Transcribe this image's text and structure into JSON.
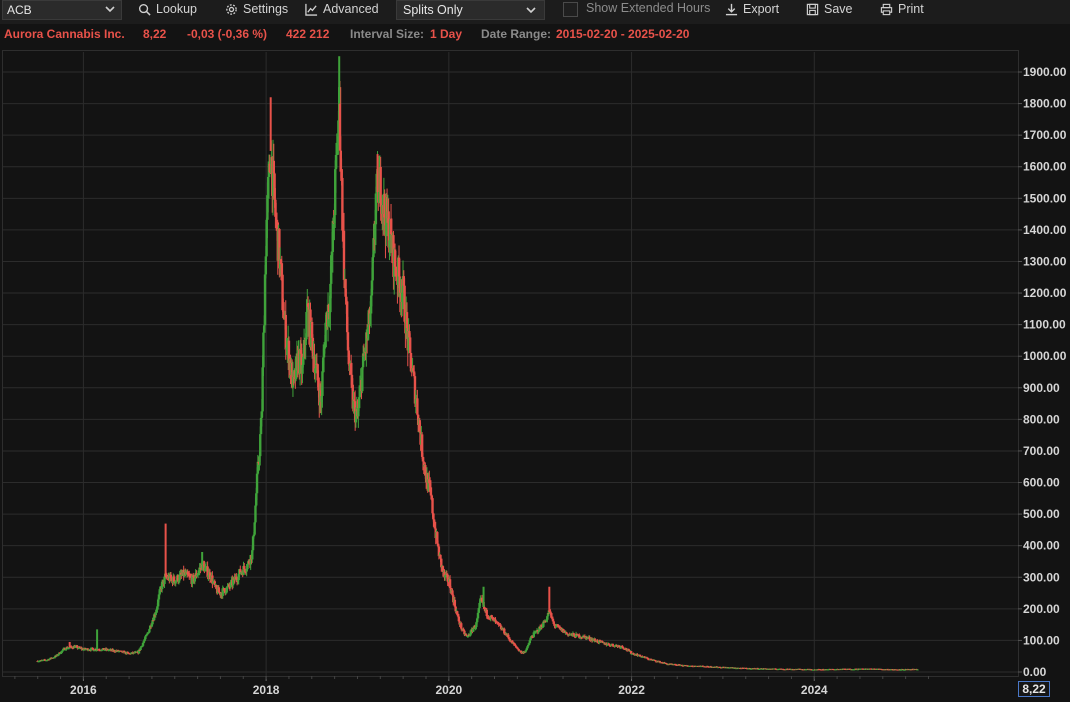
{
  "toolbar": {
    "symbol": "ACB",
    "lookup": "Lookup",
    "settings": "Settings",
    "advanced": "Advanced",
    "splits_select": "Splits Only",
    "extended_hours": "Show Extended Hours",
    "export": "Export",
    "save": "Save",
    "print": "Print"
  },
  "info": {
    "company": "Aurora Cannabis Inc.",
    "last": "8,22",
    "change": "-0,03 (-0,36 %)",
    "volume": "422 212",
    "interval_label": "Interval Size:",
    "interval_value": "1 Day",
    "range_label": "Date Range:",
    "range_value": "2015-02-20 - 2025-02-20"
  },
  "colors": {
    "up": "#3fa33a",
    "down": "#e8524a",
    "grid": "#2c2c2c",
    "accent": "#e8524a"
  },
  "chart_data": {
    "type": "candlestick",
    "ylim": [
      0,
      1900
    ],
    "yticks": [
      "1900.00",
      "1800.00",
      "1700.00",
      "1600.00",
      "1500.00",
      "1400.00",
      "1300.00",
      "1200.00",
      "1100.00",
      "1000.00",
      "900.00",
      "800.00",
      "700.00",
      "600.00",
      "500.00",
      "400.00",
      "300.00",
      "200.00",
      "100.00",
      "0.00"
    ],
    "xticks": [
      {
        "label": "2016",
        "x": 2016.0
      },
      {
        "label": "2018",
        "x": 2018.0
      },
      {
        "label": "2020",
        "x": 2020.0
      },
      {
        "label": "2022",
        "x": 2022.0
      },
      {
        "label": "2024",
        "x": 2024.0
      }
    ],
    "xlim": [
      2015.12,
      2026.23
    ],
    "last_value_label": "8,22",
    "price_path": [
      [
        2015.5,
        35
      ],
      [
        2015.6,
        38
      ],
      [
        2015.7,
        50
      ],
      [
        2015.8,
        75
      ],
      [
        2015.9,
        80
      ],
      [
        2016.0,
        72
      ],
      [
        2016.2,
        72
      ],
      [
        2016.4,
        65
      ],
      [
        2016.5,
        58
      ],
      [
        2016.6,
        62
      ],
      [
        2016.7,
        120
      ],
      [
        2016.8,
        200
      ],
      [
        2016.85,
        270
      ],
      [
        2016.9,
        300
      ],
      [
        2017.0,
        290
      ],
      [
        2017.1,
        310
      ],
      [
        2017.2,
        290
      ],
      [
        2017.3,
        340
      ],
      [
        2017.4,
        300
      ],
      [
        2017.45,
        260
      ],
      [
        2017.5,
        250
      ],
      [
        2017.6,
        270
      ],
      [
        2017.7,
        310
      ],
      [
        2017.8,
        340
      ],
      [
        2017.85,
        380
      ],
      [
        2017.9,
        600
      ],
      [
        2017.95,
        800
      ],
      [
        2018.0,
        1400
      ],
      [
        2018.05,
        1650
      ],
      [
        2018.1,
        1450
      ],
      [
        2018.15,
        1300
      ],
      [
        2018.2,
        1100
      ],
      [
        2018.3,
        900
      ],
      [
        2018.35,
        1000
      ],
      [
        2018.4,
        950
      ],
      [
        2018.45,
        1150
      ],
      [
        2018.5,
        1050
      ],
      [
        2018.55,
        950
      ],
      [
        2018.6,
        850
      ],
      [
        2018.65,
        1100
      ],
      [
        2018.7,
        1200
      ],
      [
        2018.75,
        1500
      ],
      [
        2018.8,
        1800
      ],
      [
        2018.85,
        1300
      ],
      [
        2018.9,
        1000
      ],
      [
        2018.95,
        850
      ],
      [
        2019.0,
        800
      ],
      [
        2019.05,
        950
      ],
      [
        2019.1,
        1050
      ],
      [
        2019.15,
        1150
      ],
      [
        2019.2,
        1500
      ],
      [
        2019.25,
        1550
      ],
      [
        2019.3,
        1450
      ],
      [
        2019.35,
        1400
      ],
      [
        2019.4,
        1300
      ],
      [
        2019.45,
        1250
      ],
      [
        2019.5,
        1200
      ],
      [
        2019.55,
        1050
      ],
      [
        2019.6,
        950
      ],
      [
        2019.65,
        850
      ],
      [
        2019.7,
        720
      ],
      [
        2019.75,
        620
      ],
      [
        2019.8,
        560
      ],
      [
        2019.85,
        450
      ],
      [
        2019.9,
        360
      ],
      [
        2019.95,
        300
      ],
      [
        2020.0,
        290
      ],
      [
        2020.05,
        230
      ],
      [
        2020.1,
        170
      ],
      [
        2020.15,
        130
      ],
      [
        2020.2,
        110
      ],
      [
        2020.3,
        150
      ],
      [
        2020.35,
        230
      ],
      [
        2020.4,
        190
      ],
      [
        2020.5,
        160
      ],
      [
        2020.6,
        130
      ],
      [
        2020.7,
        90
      ],
      [
        2020.8,
        60
      ],
      [
        2020.85,
        70
      ],
      [
        2020.9,
        110
      ],
      [
        2021.0,
        140
      ],
      [
        2021.05,
        160
      ],
      [
        2021.1,
        190
      ],
      [
        2021.15,
        150
      ],
      [
        2021.3,
        120
      ],
      [
        2021.5,
        110
      ],
      [
        2021.7,
        90
      ],
      [
        2021.9,
        80
      ],
      [
        2022.0,
        60
      ],
      [
        2022.2,
        40
      ],
      [
        2022.4,
        25
      ],
      [
        2022.6,
        20
      ],
      [
        2022.8,
        18
      ],
      [
        2023.0,
        15
      ],
      [
        2023.2,
        12
      ],
      [
        2023.5,
        10
      ],
      [
        2023.8,
        9
      ],
      [
        2024.0,
        8
      ],
      [
        2024.3,
        9
      ],
      [
        2024.6,
        10
      ],
      [
        2024.9,
        8
      ],
      [
        2025.13,
        8.22
      ]
    ],
    "spikes": [
      [
        2015.85,
        95
      ],
      [
        2016.15,
        135
      ],
      [
        2016.9,
        470
      ],
      [
        2017.3,
        380
      ],
      [
        2018.05,
        1820
      ],
      [
        2018.8,
        1950
      ],
      [
        2019.22,
        1640
      ],
      [
        2020.38,
        270
      ],
      [
        2021.1,
        270
      ]
    ]
  }
}
